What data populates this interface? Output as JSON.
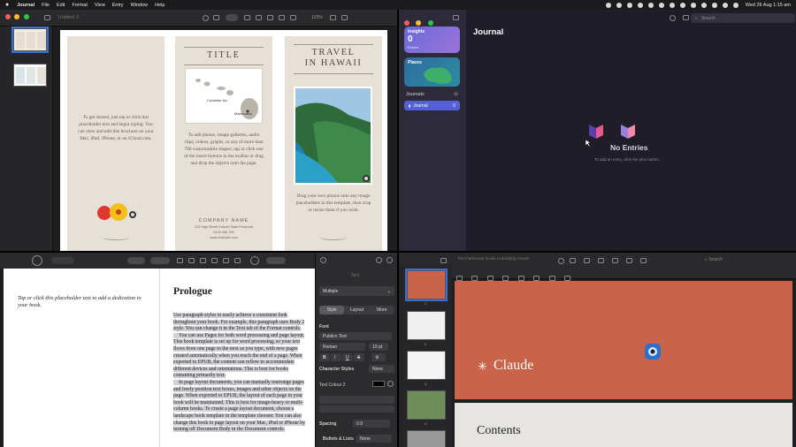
{
  "menubar": {
    "app": "Journal",
    "items": [
      "File",
      "Edit",
      "Format",
      "View",
      "Entry",
      "Window",
      "Help"
    ],
    "clock": "Wed 26 Aug  1:15 am"
  },
  "brochure": {
    "window_title": "Untitled 2",
    "zoom": "125%",
    "col1_text": "To get started, just tap or click this placeholder text and begin typing. You can view and edit this brochure on your Mac, iPad, iPhone, or on iCloud.com.",
    "col2_title": "TITLE",
    "map_label_1": "Curabitur leo",
    "map_label_2": "Malesuada",
    "col2_text": "To add photos, image galleries, audio clips, videos, graphs, or any of more than 700 customisable shapes, tap or click one of the insert buttons in the toolbar or drag and drop the objects onto the page.",
    "company_name": "COMPANY NAME",
    "company_address": "123 High Street Suburb State Postcode",
    "company_phone": "0123 456 789",
    "company_web": "www.example.com",
    "col3_title_1": "TRAVEL",
    "col3_title_2": "IN HAWAII",
    "col3_text": "Drag your own photos onto any image placeholders in this template, then crop or resize them if you wish."
  },
  "journal": {
    "insights_label": "Insights",
    "insights_count": "0",
    "insights_sub": "Entries",
    "places_label": "Places",
    "journals_header": "Journals",
    "journal_item": "Journal",
    "journal_item_count": "0",
    "title": "Journal",
    "search_placeholder": "Search",
    "empty_title": "No Entries",
    "empty_sub": "To add an entry, click the plus button."
  },
  "book": {
    "dedication": "Tap or click this placeholder text to add a dedication to your book.",
    "heading": "Prologue",
    "para1": "Use paragraph styles to easily achieve a consistent look throughout your book. For example, this paragraph uses Body 2 style. You can change it in the Text tab of the Format controls.",
    "para2": "You can use Pages for both word processing and page layout. This book template is set up for word processing, so your text flows from one page to the next as you type, with new pages created automatically when you reach the end of a page. When exported to EPUB, the content can reflow to accommodate different devices and orientations. This is best for books containing primarily text.",
    "para3": "In page layout documents, you can manually rearrange pages and freely position text boxes, images and other objects on the page. When exported to EPUB, the layout of each page in your book will be maintained. This is best for image-heavy or multi-column books. To create a page layout document, choose a landscape book template in the template chooser. You can also change this book to page layout on your Mac, iPad or iPhone by turning off Document Body in the Document controls.",
    "inspector": {
      "header": "Text",
      "paragraph_style": "Multiple",
      "tab_style": "Style",
      "tab_layout": "Layout",
      "tab_more": "More",
      "font_label": "Font",
      "font_name": "Publico Text",
      "font_style": "Roman",
      "font_size": "10 pt",
      "bold": "B",
      "italic": "I",
      "underline": "U",
      "strike": "S",
      "char_styles_label": "Character Styles",
      "char_styles_value": "None",
      "text_colour_label": "Text Colour 2",
      "spacing_label": "Spacing",
      "spacing_value": "0.9",
      "bullets_label": "Bullets & Lists",
      "bullets_value": "None"
    }
  },
  "keynote": {
    "window_title": "The Intellectual Guide to Building Claude",
    "search_placeholder": "Search",
    "slide1_title": "Claude",
    "slide2_title": "Contents",
    "thumb_numbers": [
      "1",
      "2",
      "3",
      "4"
    ]
  },
  "colors": {
    "accent": "#3a6fd8",
    "journal_accent": "#5560d6",
    "claude_slide": "#c9634a"
  }
}
